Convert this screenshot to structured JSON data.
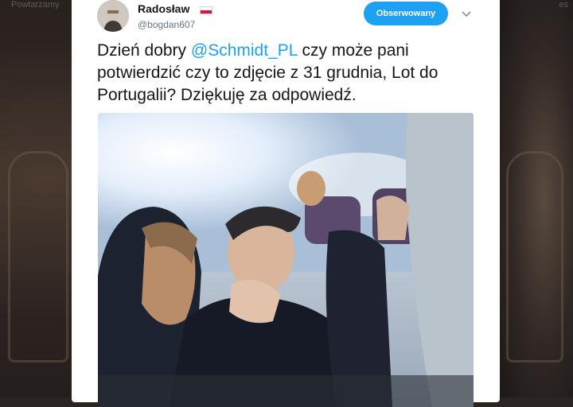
{
  "background": {
    "left_text": "Powtarzamy",
    "right_text": "es"
  },
  "tweet": {
    "author": {
      "display_name": "Radosław",
      "handle": "@bogdan607",
      "flag": "poland-flag"
    },
    "follow_button": "Obserwowany",
    "menu_icon": "chevron-down-icon",
    "text_before": "Dzień dobry ",
    "mention": "@Schmidt_PL",
    "text_after": " czy może pani potwierdzić czy to zdjęcie z 31 grudnia, Lot do Portugalii? Dziękuję za odpowiedź."
  },
  "colors": {
    "accent": "#1da1f2",
    "text": "#14171a",
    "muted": "#657786"
  }
}
